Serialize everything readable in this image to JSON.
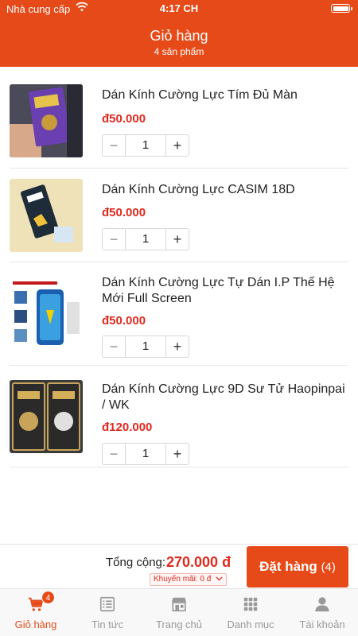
{
  "status_bar": {
    "carrier": "Nhà cung cấp",
    "time": "4:17 CH"
  },
  "header": {
    "title": "Giỏ hàng",
    "subtitle": "4 sản phẩm"
  },
  "cart": {
    "items": [
      {
        "name": "Dán Kính Cường Lực Tím Đủ Màn",
        "price": "đ50.000",
        "quantity": "1",
        "minus": "−",
        "plus": "+"
      },
      {
        "name": "Dán Kính Cường Lực CASIM 18D",
        "price": "đ50.000",
        "quantity": "1",
        "minus": "−",
        "plus": "+"
      },
      {
        "name": "Dán Kính Cường Lực Tự Dán I.P Thế Hệ Mới Full Screen",
        "price": "đ50.000",
        "quantity": "1",
        "minus": "−",
        "plus": "+"
      },
      {
        "name": "Dán Kính Cường Lực 9D Sư Tử Haopinpai / WK",
        "price": "đ120.000",
        "quantity": "1",
        "minus": "−",
        "plus": "+"
      }
    ]
  },
  "footer": {
    "total_label": "Tổng cộng:",
    "total_value": "270.000 đ",
    "promo": "Khuyến mãi: 0 đ",
    "order_label": "Đặt hàng",
    "order_count": "(4)"
  },
  "tabbar": {
    "cart_badge": "4",
    "tabs": [
      {
        "label": "Giỏ hàng",
        "icon": "cart-icon"
      },
      {
        "label": "Tin tức",
        "icon": "news-icon"
      },
      {
        "label": "Trang chủ",
        "icon": "store-icon"
      },
      {
        "label": "Danh mục",
        "icon": "grid-icon"
      },
      {
        "label": "Tài khoản",
        "icon": "user-icon"
      }
    ]
  },
  "colors": {
    "accent": "#e64a19",
    "price": "#e02a1e",
    "inactive": "#999999"
  }
}
